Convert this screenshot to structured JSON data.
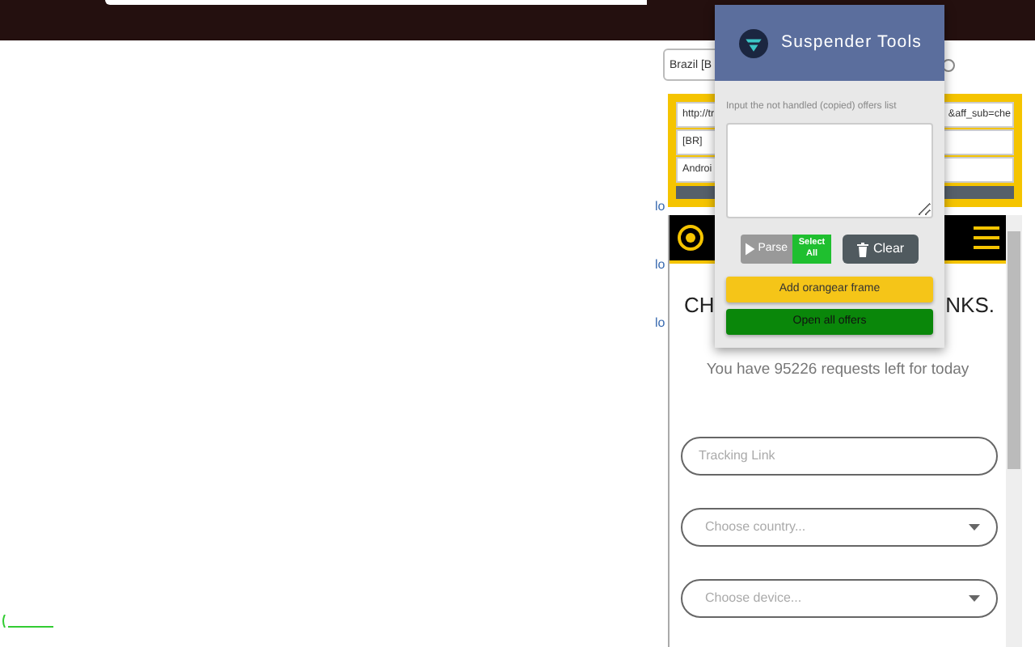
{
  "page": {
    "country_select": "Brazil [B",
    "offer_fields": [
      {
        "left": "http://tr",
        "right": "&aff_sub=che"
      },
      {
        "left": "[BR]"
      },
      {
        "left": "Androi"
      }
    ],
    "side_labels": [
      "lo",
      "lo",
      "lo"
    ]
  },
  "site": {
    "heading_left": "CH",
    "heading_right": "NKS.",
    "requests": "You have 95226 requests left for today",
    "fields": [
      {
        "kind": "text",
        "placeholder": "Tracking Link"
      },
      {
        "kind": "select",
        "placeholder": "Choose country..."
      },
      {
        "kind": "select",
        "placeholder": "Choose device..."
      }
    ]
  },
  "popup": {
    "title": "Suspender Tools",
    "prompt": "Input the not handled (copied) offers list",
    "buttons": [
      {
        "kind": "parse",
        "label": "Parse",
        "disabled": true
      },
      {
        "kind": "select",
        "label": "Select All",
        "disabled": false
      },
      {
        "kind": "clear",
        "label": "Clear",
        "disabled": false
      }
    ],
    "actions": [
      {
        "kind": "frame",
        "label": "Add orangear frame"
      },
      {
        "kind": "open",
        "label": "Open all offers"
      }
    ]
  }
}
